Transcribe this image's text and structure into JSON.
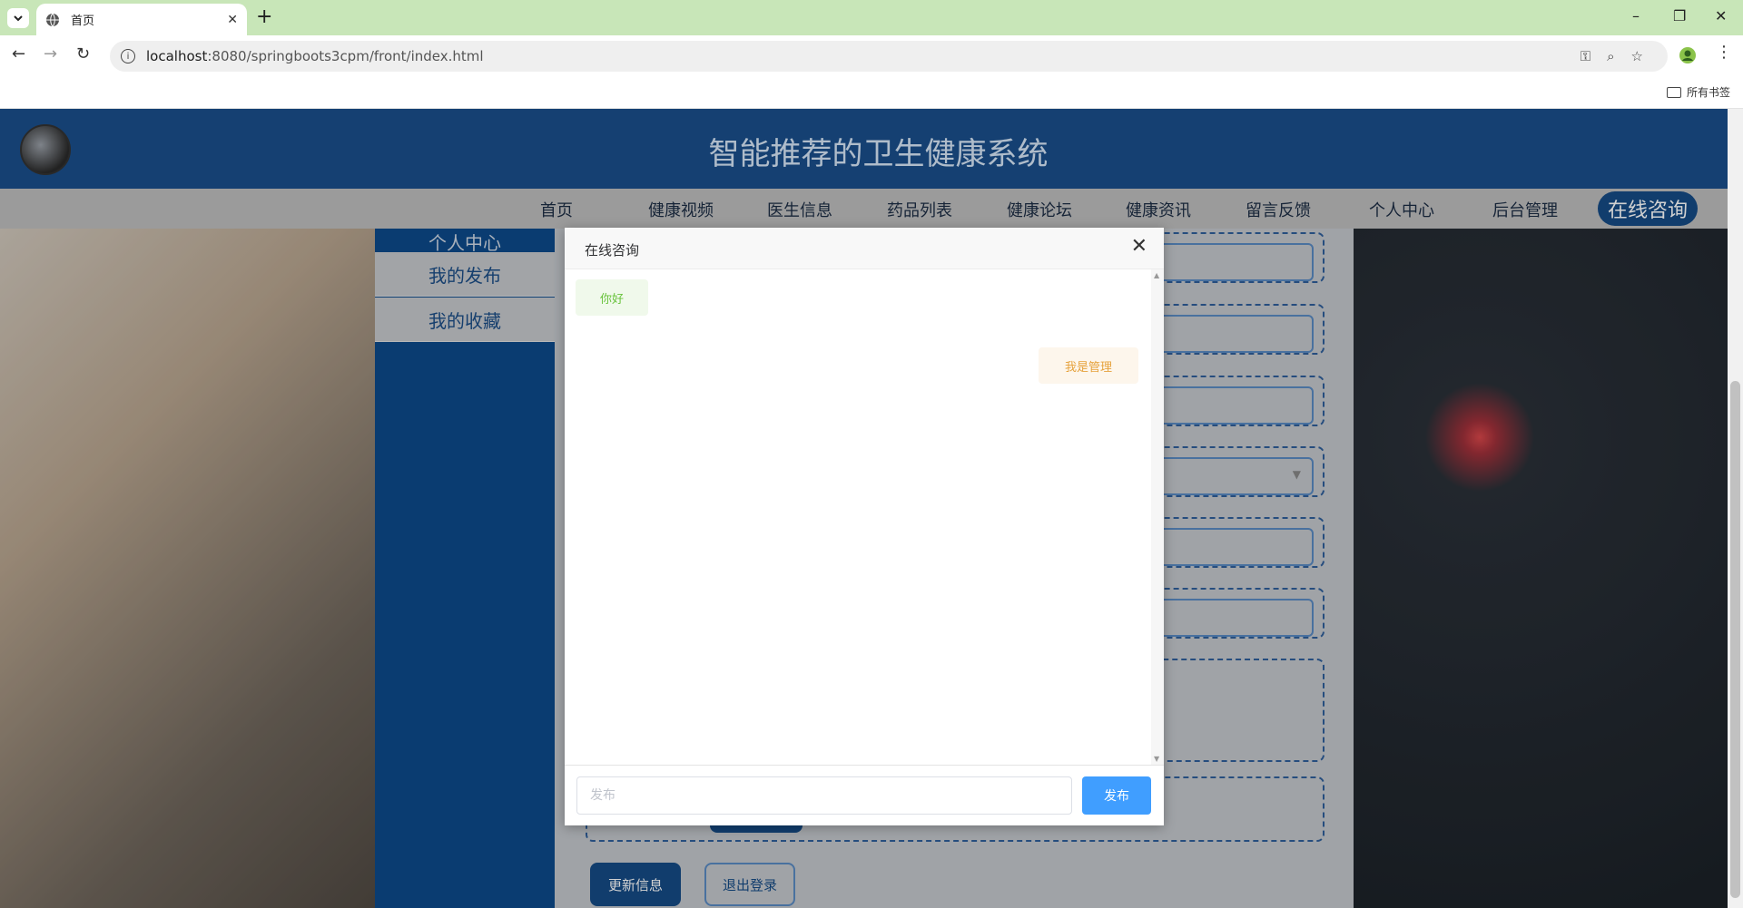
{
  "browser": {
    "tab_title": "首页",
    "url_host": "localhost",
    "url_rest": ":8080/springboots3cpm/front/index.html",
    "bookmarks_label": "所有书签"
  },
  "site": {
    "title": "智能推荐的卫生健康系统",
    "nav": [
      "首页",
      "健康视频",
      "医生信息",
      "药品列表",
      "健康论坛",
      "健康资讯",
      "留言反馈",
      "个人中心",
      "后台管理"
    ],
    "nav_active": "在线咨询"
  },
  "sidebar": {
    "header": "个人中心",
    "items": [
      "我的发布",
      "我的收藏"
    ]
  },
  "form": {
    "update_label": "更新信息",
    "logout_label": "退出登录"
  },
  "dialog": {
    "title": "在线咨询",
    "messages": [
      {
        "side": "left",
        "text": "你好"
      },
      {
        "side": "right",
        "text": "我是管理"
      }
    ],
    "input_placeholder": "发布",
    "send_label": "发布"
  },
  "colors": {
    "header_bg": "#1a4f8c",
    "nav_active_bg": "#154b86",
    "send_button": "#409eff",
    "msg_left_bg": "#f0f9eb",
    "msg_left_text": "#67c23a",
    "msg_right_bg": "#fdf6ec",
    "msg_right_text": "#e6a23c"
  }
}
